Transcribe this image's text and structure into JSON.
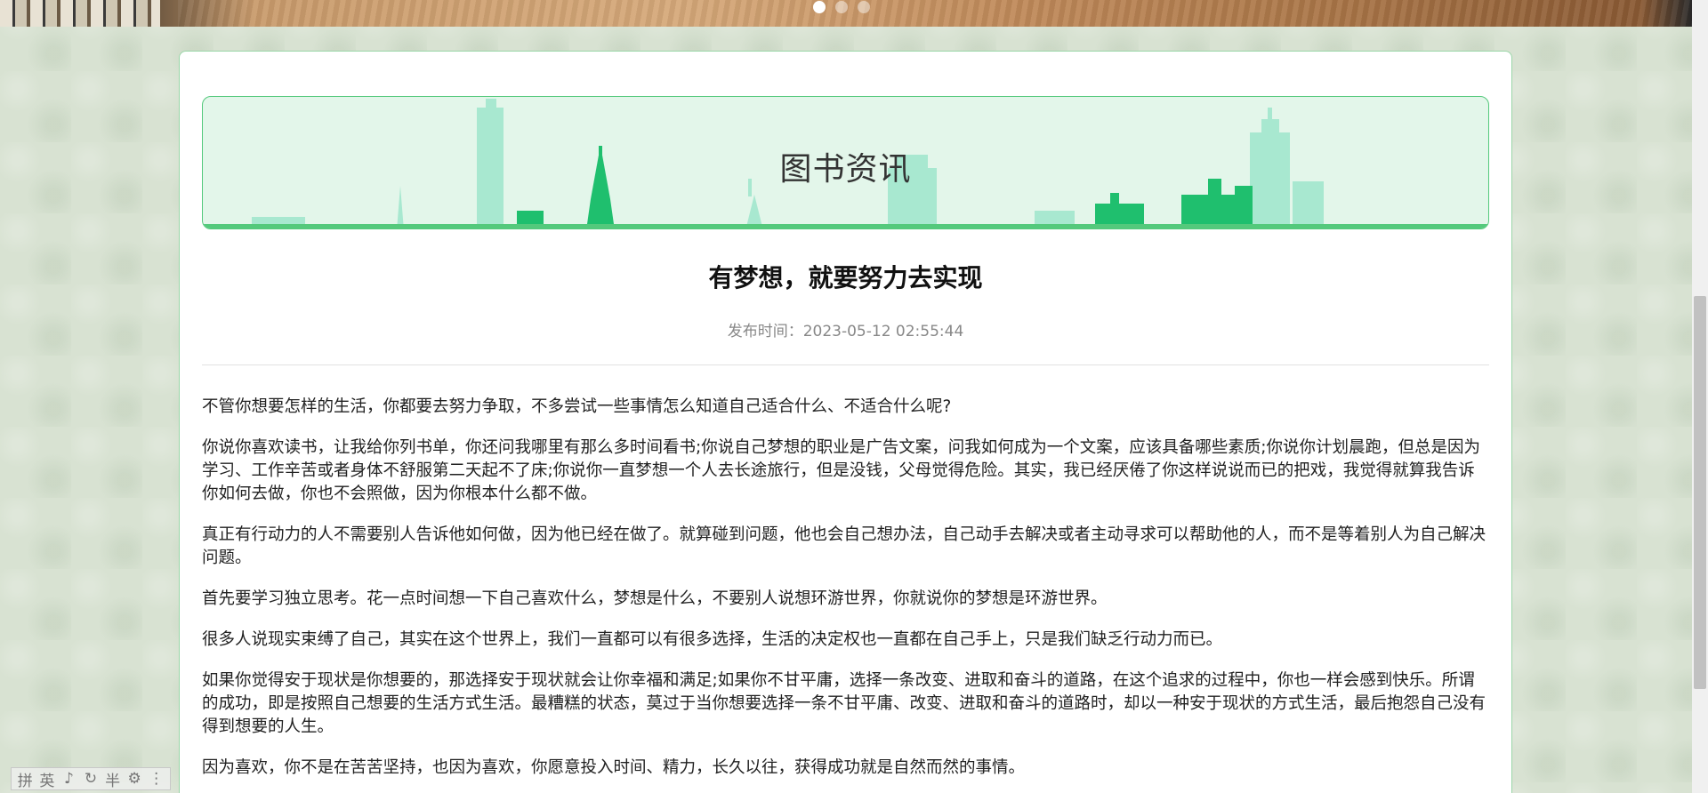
{
  "banner": {
    "carousel_dots": 3,
    "active_dot": 0
  },
  "header_banner": {
    "title": "图书资讯"
  },
  "article": {
    "title": "有梦想，就要努力去实现",
    "publish_time": "发布时间：2023-05-12 02:55:44",
    "paragraphs": [
      "不管你想要怎样的生活，你都要去努力争取，不多尝试一些事情怎么知道自己适合什么、不适合什么呢?",
      "你说你喜欢读书，让我给你列书单，你还问我哪里有那么多时间看书;你说自己梦想的职业是广告文案，问我如何成为一个文案，应该具备哪些素质;你说你计划晨跑，但总是因为学习、工作辛苦或者身体不舒服第二天起不了床;你说你一直梦想一个人去长途旅行，但是没钱，父母觉得危险。其实，我已经厌倦了你这样说说而已的把戏，我觉得就算我告诉你如何去做，你也不会照做，因为你根本什么都不做。",
      "真正有行动力的人不需要别人告诉他如何做，因为他已经在做了。就算碰到问题，他也会自己想办法，自己动手去解决或者主动寻求可以帮助他的人，而不是等着别人为自己解决问题。",
      "首先要学习独立思考。花一点时间想一下自己喜欢什么，梦想是什么，不要别人说想环游世界，你就说你的梦想是环游世界。",
      "很多人说现实束缚了自己，其实在这个世界上，我们一直都可以有很多选择，生活的决定权也一直都在自己手上，只是我们缺乏行动力而已。",
      "如果你觉得安于现状是你想要的，那选择安于现状就会让你幸福和满足;如果你不甘平庸，选择一条改变、进取和奋斗的道路，在这个追求的过程中，你也一样会感到快乐。所谓的成功，即是按照自己想要的生活方式生活。最糟糕的状态，莫过于当你想要选择一条不甘平庸、改变、进取和奋斗的道路时，却以一种安于现状的方式生活，最后抱怨自己没有得到想要的人生。",
      "因为喜欢，你不是在苦苦坚持，也因为喜欢，你愿意投入时间、精力，长久以往，获得成功就是自然而然的事情。"
    ]
  },
  "ime_toolbar": {
    "items": [
      "拼",
      "英",
      "♪",
      "↻",
      "半",
      "⚙",
      "⋮"
    ]
  },
  "colors": {
    "accent_green": "#54c97c",
    "banner_bg": "#e3f6ea",
    "skyline_light": "#a8e8d0",
    "skyline_dark": "#1fbf6e"
  }
}
